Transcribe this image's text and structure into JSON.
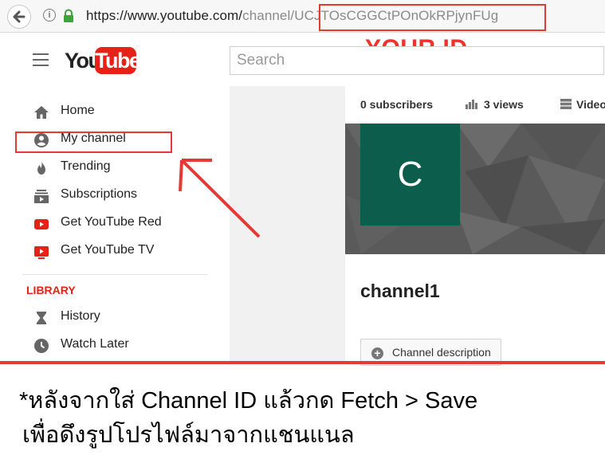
{
  "browser": {
    "url_host": "https://www.youtube.com/",
    "url_path_prefix": "channel/",
    "url_channel_id": "UCJTOsCGGCtPOnOkRPjynFUg"
  },
  "annotation": {
    "your_id_label": "YOUR ID",
    "note_line1": "*หลังจากใส่ Channel ID แล้วกด Fetch > Save",
    "note_line2": "เพื่อดึงรูปโปรไฟล์มาจากแชนแนล",
    "highlight_color": "#e53935"
  },
  "youtube": {
    "logo_you": "You",
    "logo_tube": "Tube",
    "search_placeholder": "Search",
    "brand_color": "#e62117"
  },
  "sidebar": {
    "items": [
      {
        "label": "Home",
        "icon": "home-icon"
      },
      {
        "label": "My channel",
        "icon": "account-icon"
      },
      {
        "label": "Trending",
        "icon": "flame-icon"
      },
      {
        "label": "Subscriptions",
        "icon": "subscriptions-icon"
      },
      {
        "label": "Get YouTube Red",
        "icon": "youtube-red-icon"
      },
      {
        "label": "Get YouTube TV",
        "icon": "youtube-tv-icon"
      }
    ],
    "library_heading": "LIBRARY",
    "library_items": [
      {
        "label": "History",
        "icon": "hourglass-icon"
      },
      {
        "label": "Watch Later",
        "icon": "clock-icon"
      }
    ]
  },
  "channel": {
    "subscribers": "0 subscribers",
    "views": "3 views",
    "videos": "Videos",
    "avatar_letter": "C",
    "avatar_color": "#0c5d4c",
    "name": "channel1",
    "description_button": "Channel description"
  }
}
